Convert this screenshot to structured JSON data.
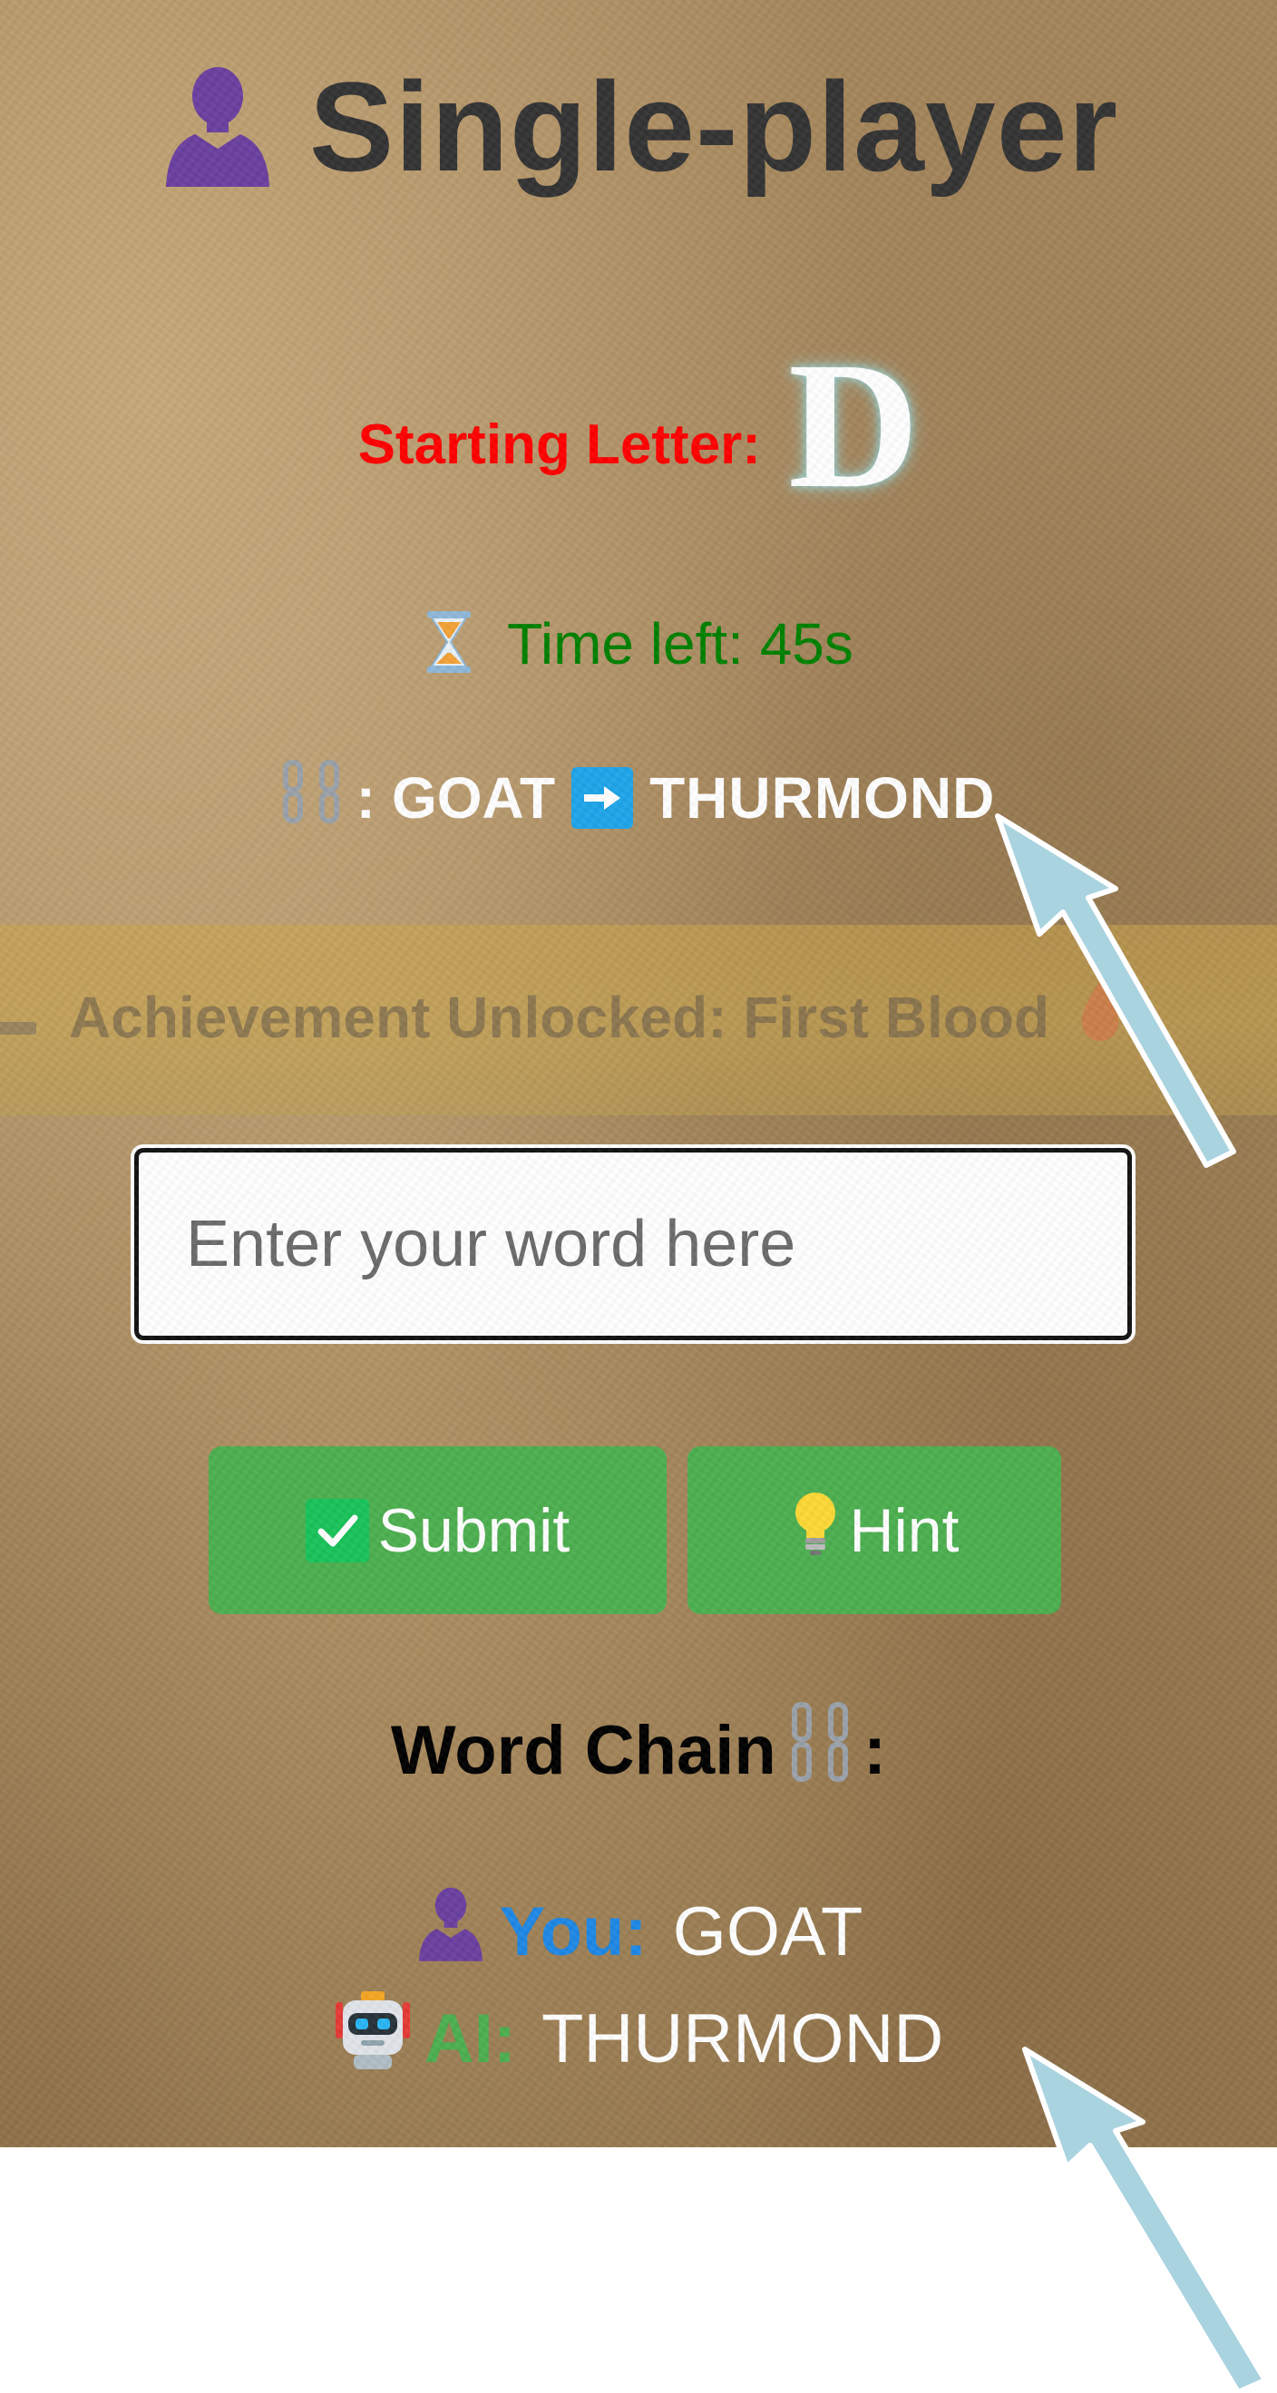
{
  "header": {
    "mode_title": "Single-player",
    "mode_icon": "person-silhouette-icon"
  },
  "game": {
    "starting_letter_label": "Starting Letter:",
    "starting_letter": "D",
    "timer_icon": "hourglass-icon",
    "time_left_text": "Time left: 45s",
    "last_move": {
      "chain_icon": "chain-icon",
      "separator": ":",
      "player_word": "GOAT",
      "arrow_icon": "right-arrow-icon",
      "ai_word": "THURMOND"
    }
  },
  "achievement_banner": {
    "text": "Achievement Unlocked: First Blood",
    "leading_icon": "trophy-icon",
    "trailing_icon": "blood-drop-icon"
  },
  "input": {
    "placeholder": "Enter your word here",
    "value": ""
  },
  "buttons": {
    "submit_label": "Submit",
    "submit_icon": "check-mark-icon",
    "hint_label": "Hint",
    "hint_icon": "lightbulb-icon"
  },
  "chain": {
    "title": "Word Chain",
    "title_icon": "chain-icon",
    "title_suffix": ":",
    "entries": [
      {
        "icon": "person-silhouette-icon",
        "label": "You:",
        "word": "GOAT"
      },
      {
        "icon": "robot-icon",
        "label": "AI:",
        "word": "THURMOND"
      }
    ]
  },
  "colors": {
    "title": "#333333",
    "starting_label": "#ff0000",
    "timer": "#008000",
    "button": "#4caf50",
    "you_label": "#1e88e5",
    "ai_label": "#4caf50",
    "annotation_arrow": "#a9d3df"
  }
}
